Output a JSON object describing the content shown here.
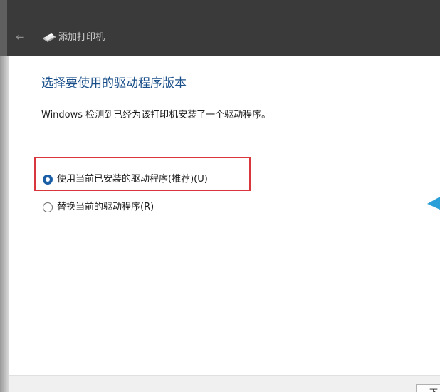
{
  "window": {
    "title": "添加打印机"
  },
  "page": {
    "heading": "选择要使用的驱动程序版本",
    "description": "Windows 检测到已经为该打印机安装了一个驱动程序。"
  },
  "options": [
    {
      "label": "使用当前已安装的驱动程序(推荐)(U)",
      "selected": true
    },
    {
      "label": "替换当前的驱动程序(R)",
      "selected": false
    }
  ],
  "footer": {
    "next_label": "下"
  },
  "colors": {
    "heading": "#1a4f8a",
    "highlight_border": "#d9363e",
    "radio_accent": "#1a5ea6",
    "titlebar": "#3a3a3a"
  },
  "icons": {
    "back": "back-arrow-icon",
    "printer": "printer-icon"
  }
}
